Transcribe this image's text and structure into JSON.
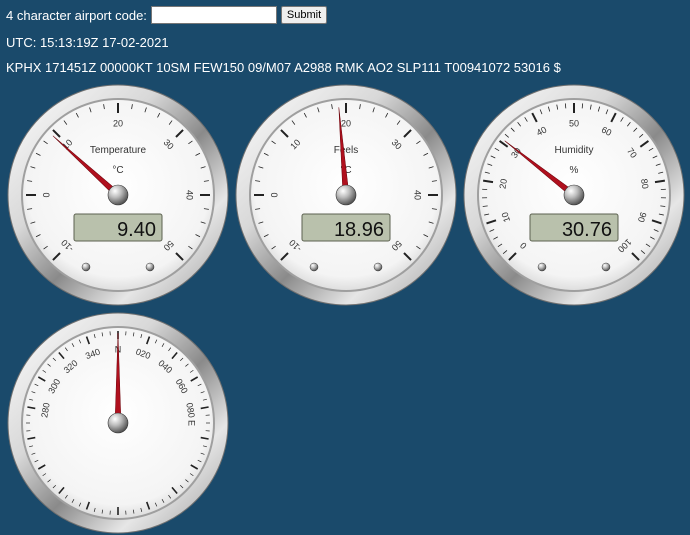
{
  "form": {
    "label": "4 character airport code:",
    "input_value": "",
    "input_placeholder": "",
    "submit_label": "Submit"
  },
  "utc": "UTC: 15:13:19Z 17-02-2021",
  "metar": "KPHX 171451Z 00000KT 10SM FEW150 09/M07 A2988 RMK AO2 SLP111 T00941072 53016 $",
  "gauges": [
    {
      "title": "Temperature",
      "unit": "°C",
      "reading": "9.40",
      "value": 9.4,
      "min": -10,
      "max": 50,
      "ticks": [
        "-10",
        "0",
        "10",
        "20",
        "30",
        "40",
        "50"
      ]
    },
    {
      "title": "Feels",
      "unit": "°C",
      "reading": "18.96",
      "value": 18.96,
      "min": -10,
      "max": 50,
      "ticks": [
        "-10",
        "0",
        "10",
        "20",
        "30",
        "40",
        "50"
      ]
    },
    {
      "title": "Humidity",
      "unit": "%",
      "reading": "30.76",
      "value": 30.76,
      "min": 0,
      "max": 100,
      "ticks": [
        "0",
        "10",
        "20",
        "30",
        "40",
        "50",
        "60",
        "70",
        "80",
        "90",
        "100"
      ]
    }
  ],
  "compass": {
    "heading": 0,
    "labels": [
      "N",
      "020",
      "040",
      "060",
      "080",
      "E",
      "280",
      "300",
      "320",
      "340"
    ]
  },
  "colors": {
    "background": "#1a4a6b",
    "needle": "#b0101e",
    "lcd": "#b9c1ac"
  }
}
